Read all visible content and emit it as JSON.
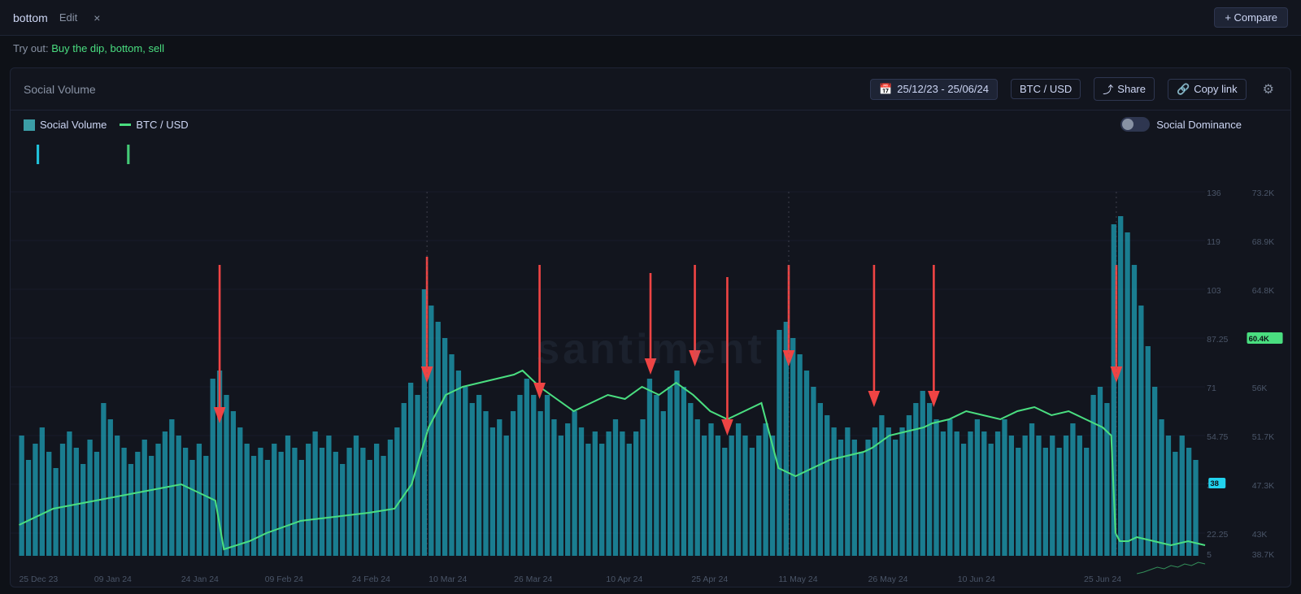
{
  "topbar": {
    "tab_name": "bottom",
    "edit_label": "Edit",
    "close_icon": "×",
    "compare_label": "+ Compare"
  },
  "tryout": {
    "prefix": "Try out:",
    "link_text": "Buy the dip, bottom, sell"
  },
  "chart": {
    "title": "Social Volume",
    "date_range": "25/12/23 - 25/06/24",
    "pair": "BTC / USD",
    "share_label": "Share",
    "copy_link_label": "Copy link",
    "settings_icon": "⚙",
    "calendar_icon": "📅",
    "share_icon": "↗",
    "copy_icon": "🔗"
  },
  "legend": {
    "social_volume_label": "Social Volume",
    "btc_usd_label": "BTC / USD",
    "social_dominance_label": "Social Dominance"
  },
  "watermark": "santiment",
  "yaxis_primary": [
    "136",
    "119",
    "103",
    "87.25",
    "71",
    "54.75",
    "38.5",
    "22.25",
    "5"
  ],
  "yaxis_secondary": [
    "73.2K",
    "68.9K",
    "64.8K",
    "60.3K",
    "56K",
    "51.7K",
    "47.3K",
    "43K",
    "38.7K"
  ],
  "xaxis": [
    "25 Dec 23",
    "09 Jan 24",
    "24 Jan 24",
    "09 Feb 24",
    "24 Feb 24",
    "10 Mar 24",
    "26 Mar 24",
    "10 Apr 24",
    "25 Apr 24",
    "11 May 24",
    "26 May 24",
    "10 Jun 24",
    "25 Jun 24"
  ],
  "price_badge": "60.4K",
  "vol_badge": "38"
}
